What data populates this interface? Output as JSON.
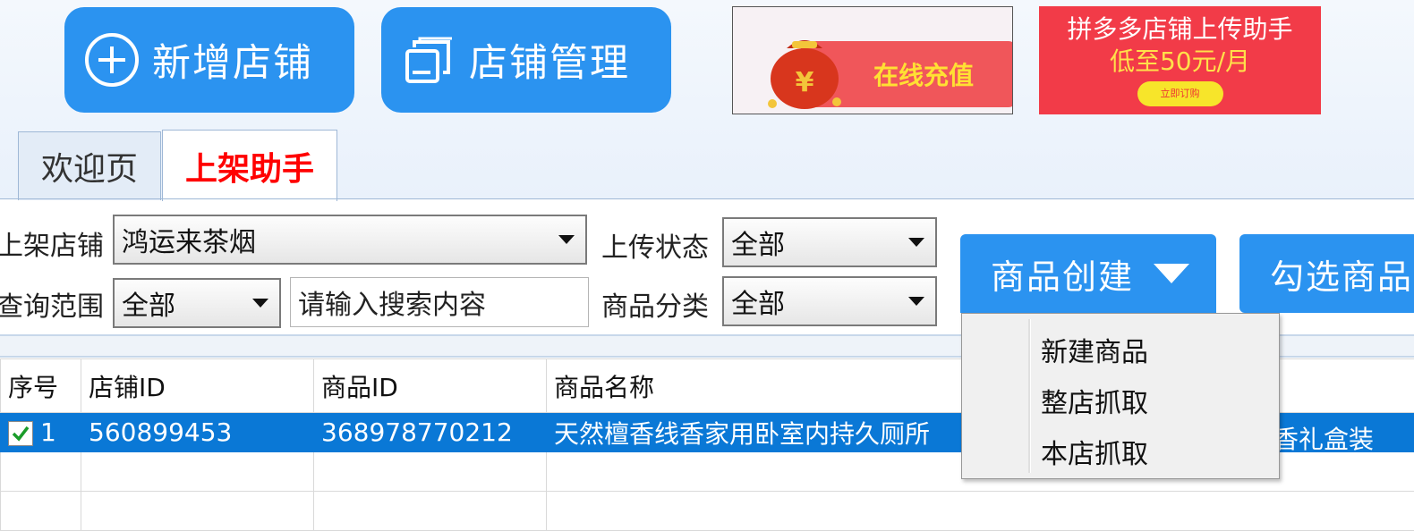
{
  "toolbar": {
    "add_store_label": "新增店铺",
    "manage_store_label": "店铺管理"
  },
  "ads": {
    "recharge_label": "在线充值",
    "pdd_title": "拼多多店铺上传助手",
    "pdd_price": "低至50元/月",
    "pdd_button": "立即订购"
  },
  "tabs": [
    {
      "label": "欢迎页"
    },
    {
      "label": "上架助手"
    }
  ],
  "filters": {
    "store_label": "上架店铺",
    "store_value": "鸿运来茶烟",
    "upload_status_label": "上传状态",
    "upload_status_value": "全部",
    "query_range_label": "查询范围",
    "query_range_value": "全部",
    "search_placeholder": "请输入搜索内容",
    "category_label": "商品分类",
    "category_value": "全部"
  },
  "actions": {
    "create_label": "商品创建",
    "select_label": "勾选商品"
  },
  "dropdown_menu": {
    "items": [
      "新建商品",
      "整店抓取",
      "本店抓取"
    ]
  },
  "table": {
    "columns": [
      "序号",
      "店铺ID",
      "商品ID",
      "商品名称"
    ],
    "rows": [
      {
        "index": "1",
        "store_id": "560899453",
        "product_id": "368978770212",
        "product_name": "天然檀香线香家用卧室内持久厕所",
        "product_name_tail": "香礼盒装",
        "checked": true
      }
    ]
  },
  "colors": {
    "primary_blue": "#2b93f0",
    "selected_row": "#0a78d6",
    "active_tab_text": "#ff0000",
    "ad_red": "#f23b48"
  }
}
